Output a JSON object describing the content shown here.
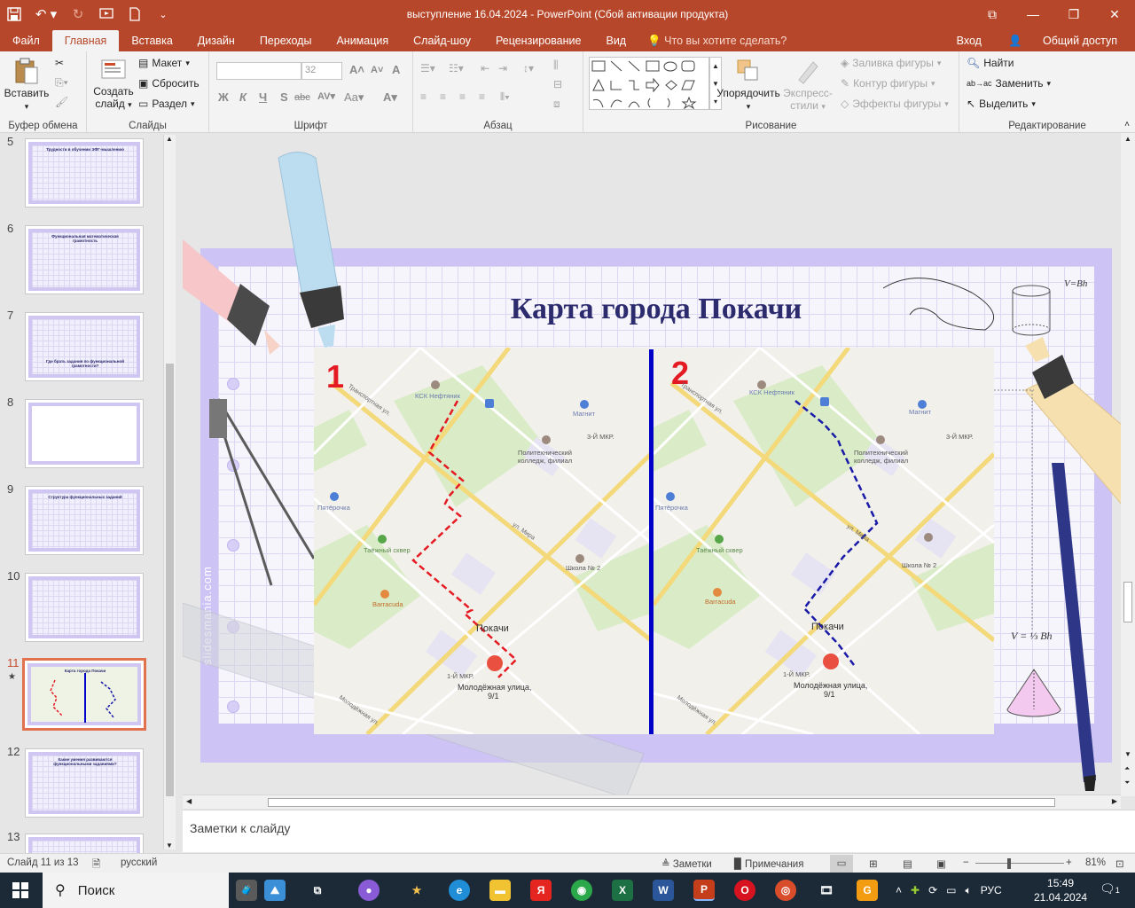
{
  "window": {
    "title": "выступление 16.04.2024 - PowerPoint (Сбой активации продукта)"
  },
  "tabs": {
    "items": [
      "Файл",
      "Главная",
      "Вставка",
      "Дизайн",
      "Переходы",
      "Анимация",
      "Слайд-шоу",
      "Рецензирование",
      "Вид"
    ],
    "tell_me": "Что вы хотите сделать?",
    "login": "Вход",
    "share": "Общий доступ"
  },
  "ribbon": {
    "clipboard": {
      "label": "Буфер обмена",
      "paste": "Вставить"
    },
    "slides": {
      "label": "Слайды",
      "new_slide_1": "Создать",
      "new_slide_2": "слайд",
      "layout": "Макет",
      "reset": "Сбросить",
      "section": "Раздел"
    },
    "font": {
      "label": "Шрифт",
      "size": "32",
      "bold": "Ж",
      "italic": "К",
      "underline": "Ч",
      "shadow": "S",
      "strike": "abc",
      "spacing": "AV",
      "case": "Aa",
      "color": "A",
      "grow": "A",
      "shrink": "A",
      "clear": "A"
    },
    "paragraph": {
      "label": "Абзац"
    },
    "drawing": {
      "label": "Рисование",
      "arrange": "Упорядочить",
      "styles_1": "Экспресс-",
      "styles_2": "стили",
      "fill": "Заливка фигуры",
      "outline": "Контур фигуры",
      "effects": "Эффекты фигуры"
    },
    "editing": {
      "label": "Редактирование",
      "find": "Найти",
      "replace": "Заменить",
      "select": "Выделить"
    }
  },
  "thumbnails": [
    {
      "number": "5",
      "title": "Трудности в обучении ЭФГ-мышлению"
    },
    {
      "number": "6",
      "title": "Функциональная математическая грамотность"
    },
    {
      "number": "7",
      "title": "Где брать задания по функциональной грамотности?"
    },
    {
      "number": "8",
      "title": ""
    },
    {
      "number": "9",
      "title": "Структура функциональных заданий"
    },
    {
      "number": "10",
      "title": ""
    },
    {
      "number": "11",
      "title": "Карта города Покачи"
    },
    {
      "number": "12",
      "title": "Какие умения развиваются функциональными заданиями?"
    },
    {
      "number": "13",
      "title": ""
    }
  ],
  "slide": {
    "title": "Карта города Покачи",
    "map_left_number": "1",
    "map_right_number": "2",
    "formula_top": "V=Bh",
    "formula_bottom": "V = ⅓ Bh",
    "watermark": "slidesmania.com",
    "map_labels": {
      "ksk": "КСК Нефтяник",
      "street1": "Транспортная ул.",
      "magnit": "Магнит",
      "college_1": "Политехнический",
      "college_2": "колледж, филиал",
      "mkr3": "3-Й МКР.",
      "pyaterochka": "Пятёрочка",
      "square": "Таёжный сквер",
      "school": "Школа № 2",
      "street2": "ул. Мира",
      "baracuda": "Barracuda",
      "city": "Покачи",
      "mkr1": "1-Й МКР.",
      "address_1": "Молодёжная улица,",
      "address_2": "9/1",
      "street3": "Молодёжная ул."
    }
  },
  "notes": {
    "placeholder": "Заметки к слайду"
  },
  "status": {
    "slide_of": "Слайд 11 из 13",
    "language": "русский",
    "notes": "Заметки",
    "comments": "Примечания",
    "zoom": "81%"
  },
  "taskbar": {
    "search": "Поиск",
    "lang": "РУС",
    "time": "15:49",
    "date": "21.04.2024",
    "notifications": "1"
  },
  "colors": {
    "accent": "#b7472a",
    "route_left": "#e51b23",
    "route_right": "#1a1aa8",
    "divider": "#0000c8",
    "slide_frame": "#cdc3f5"
  }
}
